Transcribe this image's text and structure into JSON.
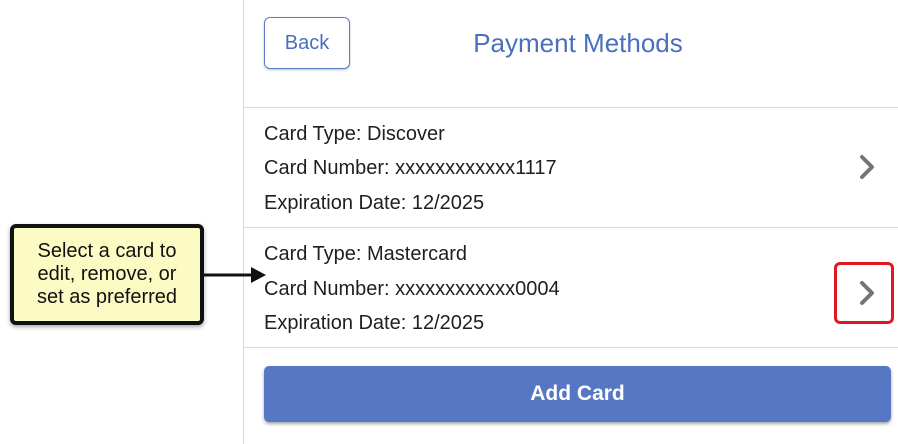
{
  "header": {
    "back_label": "Back",
    "title": "Payment Methods"
  },
  "cards": [
    {
      "type_line": "Card Type: Discover",
      "number_line": "Card Number: xxxxxxxxxxxx1117",
      "expiration_line": "Expiration Date: 12/2025"
    },
    {
      "type_line": "Card Type: Mastercard",
      "number_line": "Card Number: xxxxxxxxxxxx0004",
      "expiration_line": "Expiration Date: 12/2025"
    }
  ],
  "add_card_label": "Add Card",
  "callout": {
    "lines": [
      "Select a card to",
      "edit, remove, or",
      "set as preferred"
    ]
  },
  "colors": {
    "accent": "#5677c4",
    "title_blue": "#4a6fbf",
    "highlight_red": "#e0191e",
    "callout_bg": "#fdfbc4"
  },
  "icons": {
    "card_chevron": "chevron-right-icon",
    "callout_pointer": "arrow-left-icon"
  }
}
